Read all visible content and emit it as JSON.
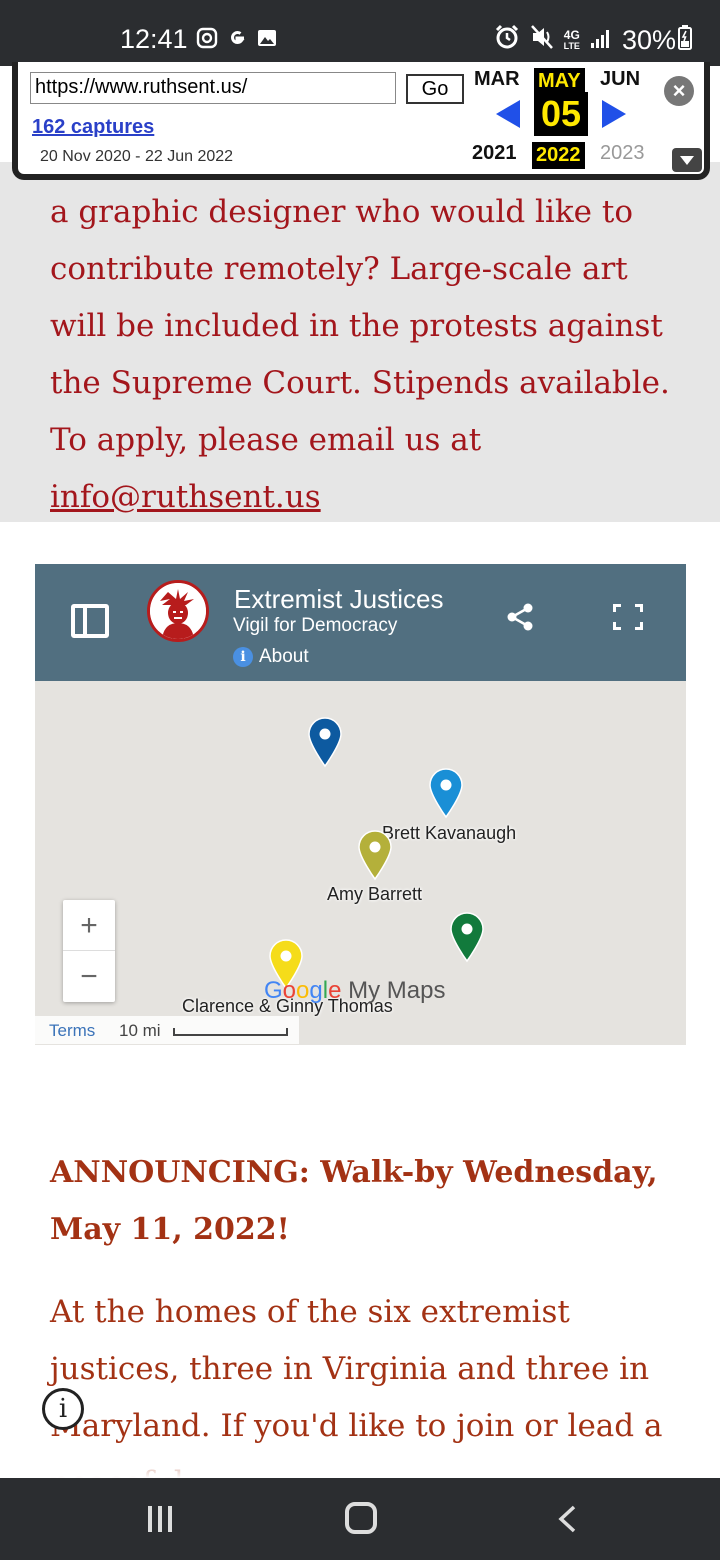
{
  "status_bar": {
    "time": "12:41",
    "left_icons": [
      "instagram-icon",
      "google-icon",
      "gallery-icon"
    ],
    "right_icons": [
      "alarm-icon",
      "mute-icon",
      "lte-icon",
      "signal-icon",
      "battery-icon"
    ],
    "network": "4G",
    "network_sub": "LTE",
    "battery": "30%"
  },
  "wayback": {
    "url": "https://www.ruthsent.us/",
    "go_label": "Go",
    "captures": "162 captures",
    "range": "20 Nov 2020 - 22 Jun 2022",
    "months": [
      "MAR",
      "MAY",
      "JUN"
    ],
    "day": "05",
    "years": [
      "2021",
      "2022",
      "2023"
    ]
  },
  "intro": {
    "text": "a graphic designer who would like to contribute remotely? Large-scale art will be included in the protests against the Supreme Court. Stipends available. To apply, please email us at ",
    "email": "info@ruthsent.us"
  },
  "map": {
    "title": "Extremist Justices",
    "subtitle": "Vigil for Democracy",
    "about": "About",
    "pins": [
      {
        "label": "",
        "color": "#0d5aa0"
      },
      {
        "label": "Brett Kavanaugh",
        "color": "#1a8fd6"
      },
      {
        "label": "Amy Barrett",
        "color": "#b4b03a"
      },
      {
        "label": "",
        "color": "#127a3c"
      },
      {
        "label": "Clarence & Ginny Thomas",
        "color": "#f5dc1a"
      }
    ],
    "zoom_in": "+",
    "zoom_out": "−",
    "brand_google": [
      "G",
      "o",
      "o",
      "g",
      "l",
      "e"
    ],
    "brand_suffix": " My Maps",
    "terms": "Terms",
    "scale": "10 mi"
  },
  "announcement": {
    "heading": "ANNOUNCING: Walk-by Wednesday, May 11, 2022!",
    "body": "At the homes of the six extremist justices, three in Virginia and three in Maryland. If you'd like to join or lead a peaceful"
  },
  "info_button": "i"
}
